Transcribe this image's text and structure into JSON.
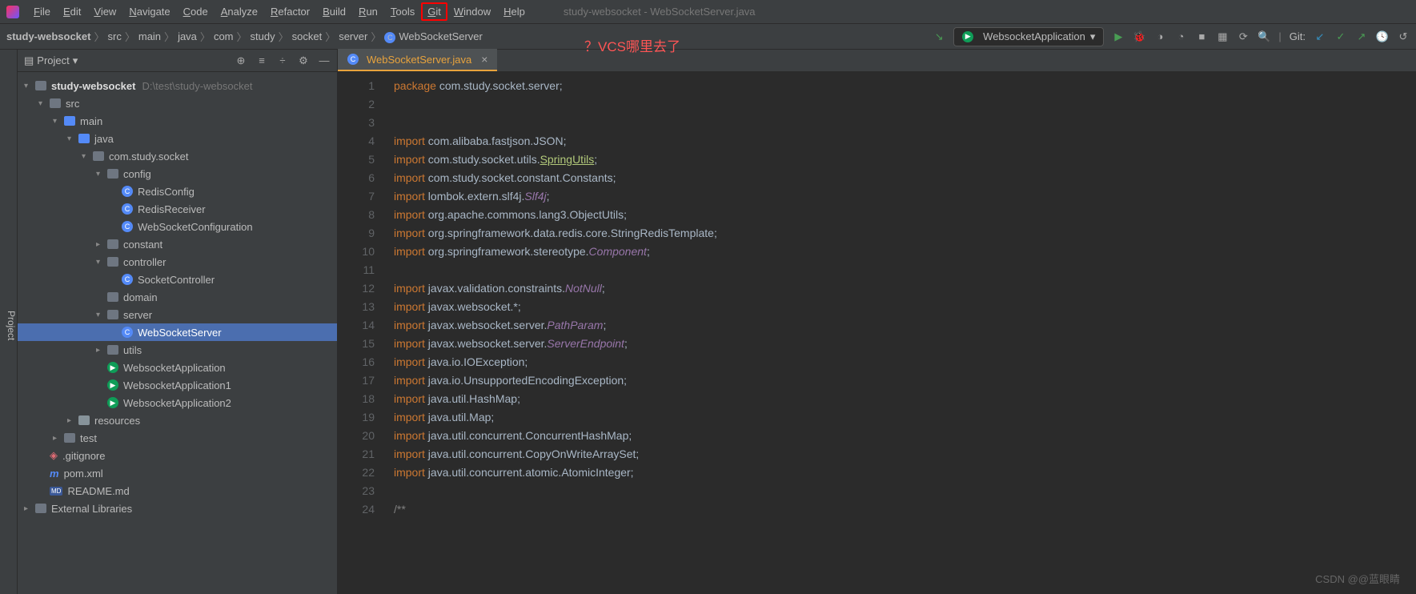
{
  "menu": [
    "File",
    "Edit",
    "View",
    "Navigate",
    "Code",
    "Analyze",
    "Refactor",
    "Build",
    "Run",
    "Tools",
    "Git",
    "Window",
    "Help"
  ],
  "window_title": "study-websocket - WebSocketServer.java",
  "annotation": "？VCS哪里去了",
  "breadcrumb": [
    "study-websocket",
    "src",
    "main",
    "java",
    "com",
    "study",
    "socket",
    "server",
    "WebSocketServer"
  ],
  "run_config": "WebsocketApplication",
  "git_label": "Git:",
  "panel": {
    "title": "Project"
  },
  "tree": {
    "root": "study-websocket",
    "root_path": "D:\\test\\study-websocket",
    "items": [
      {
        "d": 1,
        "t": "folder",
        "n": "src",
        "exp": true
      },
      {
        "d": 2,
        "t": "folder-blue",
        "n": "main",
        "exp": true
      },
      {
        "d": 3,
        "t": "folder-blue",
        "n": "java",
        "exp": true
      },
      {
        "d": 4,
        "t": "folder-dark",
        "n": "com.study.socket",
        "exp": true
      },
      {
        "d": 5,
        "t": "folder-dark",
        "n": "config",
        "exp": true
      },
      {
        "d": 6,
        "t": "class",
        "n": "RedisConfig"
      },
      {
        "d": 6,
        "t": "class",
        "n": "RedisReceiver"
      },
      {
        "d": 6,
        "t": "class",
        "n": "WebSocketConfiguration"
      },
      {
        "d": 5,
        "t": "folder-dark",
        "n": "constant",
        "exp": false,
        "closed": true
      },
      {
        "d": 5,
        "t": "folder-dark",
        "n": "controller",
        "exp": true
      },
      {
        "d": 6,
        "t": "class",
        "n": "SocketController"
      },
      {
        "d": 5,
        "t": "folder-dark",
        "n": "domain",
        "closed": true,
        "noarrow": true
      },
      {
        "d": 5,
        "t": "folder-dark",
        "n": "server",
        "exp": true
      },
      {
        "d": 6,
        "t": "class",
        "n": "WebSocketServer",
        "sel": true
      },
      {
        "d": 5,
        "t": "folder-dark",
        "n": "utils",
        "exp": false,
        "closed": true
      },
      {
        "d": 5,
        "t": "run",
        "n": "WebsocketApplication"
      },
      {
        "d": 5,
        "t": "run",
        "n": "WebsocketApplication1"
      },
      {
        "d": 5,
        "t": "run",
        "n": "WebsocketApplication2"
      },
      {
        "d": 3,
        "t": "folder-res",
        "n": "resources",
        "closed": true
      },
      {
        "d": 2,
        "t": "folder-dark",
        "n": "test",
        "closed": true
      },
      {
        "d": 1,
        "t": "git",
        "n": ".gitignore"
      },
      {
        "d": 1,
        "t": "maven",
        "n": "pom.xml"
      },
      {
        "d": 1,
        "t": "md",
        "n": "README.md"
      }
    ],
    "ext_lib": "External Libraries"
  },
  "tab": "WebSocketServer.java",
  "code_lines": [
    [
      [
        "kw",
        "package"
      ],
      [
        "",
        " com.study.socket.server;"
      ]
    ],
    [],
    [],
    [
      [
        "kw",
        "import"
      ],
      [
        "",
        " com.alibaba.fastjson.JSON;"
      ]
    ],
    [
      [
        "kw",
        "import"
      ],
      [
        "",
        " com.study.socket.utils."
      ],
      [
        "sf",
        "SpringUtils"
      ],
      [
        "",
        ";"
      ]
    ],
    [
      [
        "kw",
        "import"
      ],
      [
        "",
        " com.study.socket.constant.Constants;"
      ]
    ],
    [
      [
        "kw",
        "import"
      ],
      [
        "",
        " lombok.extern.slf4j."
      ],
      [
        "hl",
        "Slf4j"
      ],
      [
        "",
        ";"
      ]
    ],
    [
      [
        "kw",
        "import"
      ],
      [
        "",
        " org.apache.commons.lang3.ObjectUtils;"
      ]
    ],
    [
      [
        "kw",
        "import"
      ],
      [
        "",
        " org.springframework.data.redis.core.StringRedisTemplate;"
      ]
    ],
    [
      [
        "kw",
        "import"
      ],
      [
        "",
        " org.springframework.stereotype."
      ],
      [
        "hl",
        "Component"
      ],
      [
        "",
        ";"
      ]
    ],
    [],
    [
      [
        "kw",
        "import"
      ],
      [
        "",
        " javax.validation.constraints."
      ],
      [
        "hl",
        "NotNull"
      ],
      [
        "",
        ";"
      ]
    ],
    [
      [
        "kw",
        "import"
      ],
      [
        "",
        " javax.websocket.*;"
      ]
    ],
    [
      [
        "kw",
        "import"
      ],
      [
        "",
        " javax.websocket.server."
      ],
      [
        "hl",
        "PathParam"
      ],
      [
        "",
        ";"
      ]
    ],
    [
      [
        "kw",
        "import"
      ],
      [
        "",
        " javax.websocket.server."
      ],
      [
        "hl",
        "ServerEndpoint"
      ],
      [
        "",
        ";"
      ]
    ],
    [
      [
        "kw",
        "import"
      ],
      [
        "",
        " java.io.IOException;"
      ]
    ],
    [
      [
        "kw",
        "import"
      ],
      [
        "",
        " java.io.UnsupportedEncodingException;"
      ]
    ],
    [
      [
        "kw",
        "import"
      ],
      [
        "",
        " java.util.HashMap;"
      ]
    ],
    [
      [
        "kw",
        "import"
      ],
      [
        "",
        " java.util.Map;"
      ]
    ],
    [
      [
        "kw",
        "import"
      ],
      [
        "",
        " java.util.concurrent.ConcurrentHashMap;"
      ]
    ],
    [
      [
        "kw",
        "import"
      ],
      [
        "",
        " java.util.concurrent.CopyOnWriteArraySet;"
      ]
    ],
    [
      [
        "kw",
        "import"
      ],
      [
        "",
        " java.util.concurrent.atomic.AtomicInteger;"
      ]
    ],
    [],
    [
      [
        "comment",
        "/**"
      ]
    ]
  ],
  "watermark": "CSDN @@蓝眼睛"
}
